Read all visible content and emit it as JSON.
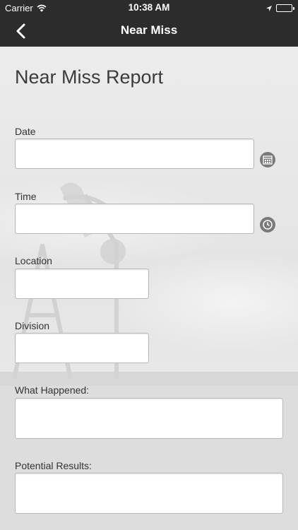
{
  "status_bar": {
    "carrier": "Carrier",
    "time": "10:38 AM"
  },
  "nav": {
    "title": "Near Miss",
    "back_icon": "chevron-left-icon"
  },
  "form": {
    "title": "Near Miss Report",
    "fields": {
      "date": {
        "label": "Date",
        "value": "",
        "icon": "calendar-icon"
      },
      "time": {
        "label": "Time",
        "value": "",
        "icon": "clock-icon"
      },
      "location": {
        "label": "Location",
        "value": ""
      },
      "division": {
        "label": "Division",
        "value": ""
      },
      "what_happened": {
        "label": "What Happened:",
        "value": ""
      },
      "potential_results": {
        "label": "Potential Results:",
        "value": ""
      }
    }
  },
  "colors": {
    "navbar": "#2c2c2c",
    "nav_text": "#ffffff",
    "icon_gray": "#7a7a7a",
    "field_border": "#b9b9b9"
  }
}
